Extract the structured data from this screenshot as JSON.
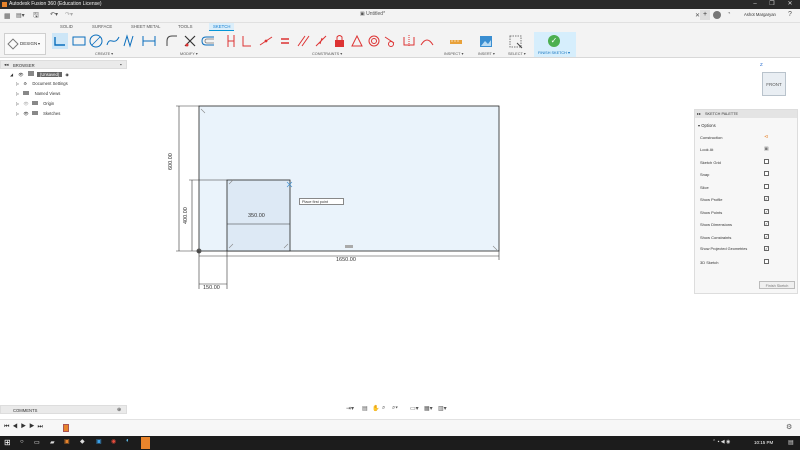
{
  "titlebar": {
    "title": "Autodesk Fusion 360 (Education License)"
  },
  "document": {
    "tab_title": "Untitled*"
  },
  "user": {
    "name": "Ashot Margaryan"
  },
  "ribbon_tabs": [
    "SOLID",
    "SURFACE",
    "SHEET METAL",
    "TOOLS",
    "SKETCH"
  ],
  "workspace": {
    "label": "DESIGN"
  },
  "groups": {
    "create": "CREATE",
    "modify": "MODIFY",
    "constraints": "CONSTRAINTS",
    "inspect": "INSPECT",
    "insert": "INSERT",
    "select": "SELECT",
    "finish": "FINISH SKETCH"
  },
  "browser": {
    "title": "BROWSER",
    "root": "(Unsaved)",
    "items": [
      "Document Settings",
      "Named Views",
      "Origin",
      "Sketches"
    ]
  },
  "viewcube": {
    "face": "FRONT",
    "axis": "Z"
  },
  "sketch": {
    "dimensions": {
      "width_total": "1650.00",
      "height_total": "600.00",
      "inner_width": "350.00",
      "inner_height": "400.00",
      "offset": "150.00"
    },
    "tooltip": "Place first point"
  },
  "palette": {
    "title": "SKETCH PALETTE",
    "section": "Options",
    "options": [
      {
        "label": "Construction",
        "state": "icon"
      },
      {
        "label": "Look At",
        "state": "icon"
      },
      {
        "label": "Sketch Grid",
        "state": "unchecked"
      },
      {
        "label": "Snap",
        "state": "unchecked"
      },
      {
        "label": "Slice",
        "state": "unchecked"
      },
      {
        "label": "Show Profile",
        "state": "checked"
      },
      {
        "label": "Show Points",
        "state": "checked"
      },
      {
        "label": "Show Dimensions",
        "state": "checked"
      },
      {
        "label": "Show Constraints",
        "state": "checked"
      },
      {
        "label": "Show Projected Geometries",
        "state": "checked"
      },
      {
        "label": "3D Sketch",
        "state": "unchecked"
      }
    ],
    "finish_button": "Finish Sketch"
  },
  "comments": {
    "title": "COMMENTS"
  },
  "taskbar": {
    "time": "10:15 PM"
  },
  "colors": {
    "accent": "#0696d7",
    "sketch_fill": "#eaf3fb",
    "titlebar": "#2a2a2a"
  }
}
